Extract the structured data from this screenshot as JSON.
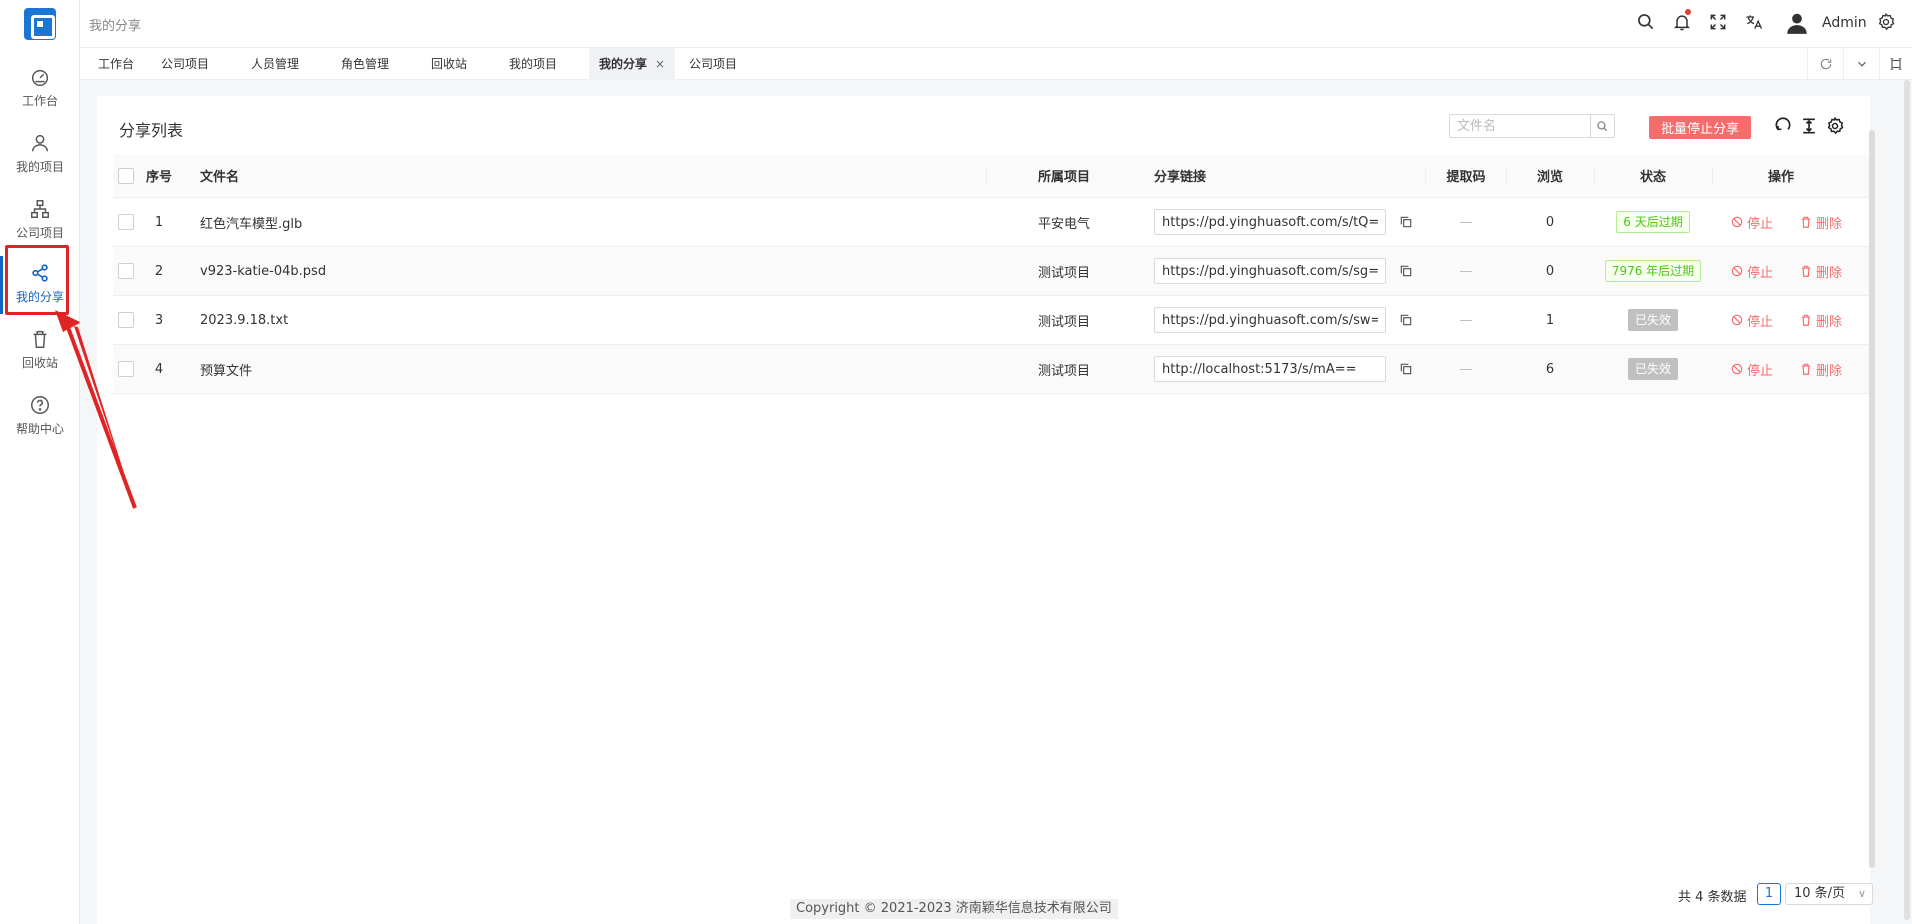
{
  "topbar": {
    "page_title": "我的分享",
    "user_name": "Admin"
  },
  "sidebar": {
    "items": [
      {
        "label": "工作台",
        "icon": "dashboard-icon"
      },
      {
        "label": "我的项目",
        "icon": "user-icon"
      },
      {
        "label": "公司项目",
        "icon": "org-chart-icon"
      },
      {
        "label": "我的分享",
        "icon": "share-icon"
      },
      {
        "label": "回收站",
        "icon": "trash-icon"
      },
      {
        "label": "帮助中心",
        "icon": "help-icon"
      }
    ],
    "active_index": 3
  },
  "tabs": [
    {
      "label": "工作台"
    },
    {
      "label": "公司项目"
    },
    {
      "label": "人员管理"
    },
    {
      "label": "角色管理"
    },
    {
      "label": "回收站"
    },
    {
      "label": "我的项目"
    },
    {
      "label": "我的分享",
      "active": true,
      "close": "×"
    },
    {
      "label": "公司项目"
    }
  ],
  "card": {
    "title": "分享列表",
    "search_placeholder": "文件名",
    "batch_stop_label": "批量停止分享"
  },
  "table": {
    "headers": {
      "index": "序号",
      "file_name": "文件名",
      "project": "所属项目",
      "link": "分享链接",
      "code": "提取码",
      "views": "浏览",
      "status": "状态",
      "actions": "操作"
    },
    "rows": [
      {
        "index": "1",
        "file_name": "红色汽车模型.glb",
        "project": "平安电气",
        "link": "https://pd.yinghuasoft.com/s/tQ==",
        "code": "—",
        "views": "0",
        "status": "6 天后过期",
        "status_type": "green"
      },
      {
        "index": "2",
        "file_name": "v923-katie-04b.psd",
        "project": "测试项目",
        "link": "https://pd.yinghuasoft.com/s/sg==",
        "code": "—",
        "views": "0",
        "status": "7976 年后过期",
        "status_type": "green"
      },
      {
        "index": "3",
        "file_name": "2023.9.18.txt",
        "project": "测试项目",
        "link": "https://pd.yinghuasoft.com/s/sw==",
        "code": "—",
        "views": "1",
        "status": "已失效",
        "status_type": "gray"
      },
      {
        "index": "4",
        "file_name": "预算文件",
        "project": "测试项目",
        "link": "http://localhost:5173/s/mA==",
        "code": "—",
        "views": "6",
        "status": "已失效",
        "status_type": "gray"
      }
    ],
    "stop_label": "停止",
    "delete_label": "删除"
  },
  "pager": {
    "total": "共 4 条数据",
    "current_page": "1",
    "page_size": "10 条/页"
  },
  "footer": {
    "copyright": "Copyright © 2021-2023 济南颖华信息技术有限公司"
  },
  "colors": {
    "primary": "#1565c0",
    "danger": "#f56c6c",
    "highlight": "#e02424"
  }
}
